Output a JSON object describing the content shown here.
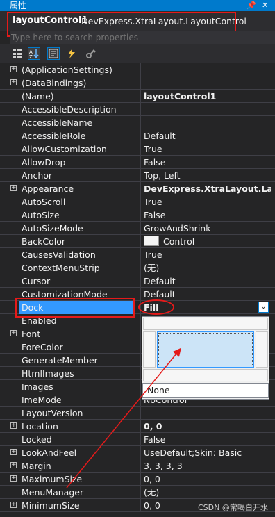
{
  "window": {
    "title": "属性",
    "pin_glyph": "📌",
    "close_glyph": "✕"
  },
  "object_selector": {
    "name": "layoutControl1",
    "type": "DevExpress.XtraLayout.LayoutControl"
  },
  "search": {
    "placeholder": "Type here to search properties"
  },
  "toolbar": {
    "buttons": [
      "categorized-icon",
      "alphabetical-icon",
      "properties-icon",
      "events-icon",
      "property-pages-icon"
    ]
  },
  "properties": [
    {
      "name": "(ApplicationSettings)",
      "value": "",
      "expandable": true
    },
    {
      "name": "(DataBindings)",
      "value": "",
      "expandable": true
    },
    {
      "name": "(Name)",
      "value": "layoutControl1",
      "bold": true
    },
    {
      "name": "AccessibleDescription",
      "value": ""
    },
    {
      "name": "AccessibleName",
      "value": ""
    },
    {
      "name": "AccessibleRole",
      "value": "Default"
    },
    {
      "name": "AllowCustomization",
      "value": "True"
    },
    {
      "name": "AllowDrop",
      "value": "False"
    },
    {
      "name": "Anchor",
      "value": "Top, Left"
    },
    {
      "name": "Appearance",
      "value": "DevExpress.XtraLayout.LayoutControlAppearance",
      "bold": true,
      "expandable": true
    },
    {
      "name": "AutoScroll",
      "value": "True"
    },
    {
      "name": "AutoSize",
      "value": "False"
    },
    {
      "name": "AutoSizeMode",
      "value": "GrowAndShrink"
    },
    {
      "name": "BackColor",
      "value": "Control",
      "swatch": true
    },
    {
      "name": "CausesValidation",
      "value": "True"
    },
    {
      "name": "ContextMenuStrip",
      "value": "(无)"
    },
    {
      "name": "Cursor",
      "value": "Default"
    },
    {
      "name": "CustomizationMode",
      "value": "Default"
    },
    {
      "name": "Dock",
      "value": "Fill",
      "bold": true,
      "selected": true
    },
    {
      "name": "Enabled",
      "value": ""
    },
    {
      "name": "Font",
      "value": "",
      "expandable": true
    },
    {
      "name": "ForeColor",
      "value": ""
    },
    {
      "name": "GenerateMember",
      "value": ""
    },
    {
      "name": "HtmlImages",
      "value": ""
    },
    {
      "name": "Images",
      "value": ""
    },
    {
      "name": "ImeMode",
      "value": "NoControl"
    },
    {
      "name": "LayoutVersion",
      "value": ""
    },
    {
      "name": "Location",
      "value": "0, 0",
      "bold": true,
      "expandable": true
    },
    {
      "name": "Locked",
      "value": "False"
    },
    {
      "name": "LookAndFeel",
      "value": "UseDefault;Skin: Basic",
      "expandable": true
    },
    {
      "name": "Margin",
      "value": "3, 3, 3, 3",
      "expandable": true
    },
    {
      "name": "MaximumSize",
      "value": "0, 0",
      "expandable": true
    },
    {
      "name": "MenuManager",
      "value": "(无)"
    },
    {
      "name": "MinimumSize",
      "value": "0, 0",
      "expandable": true
    }
  ],
  "dock_dropdown": {
    "options": [
      "Top",
      "Left",
      "Fill",
      "Right",
      "Bottom",
      "None"
    ],
    "selected": "Fill",
    "none_label": "None"
  },
  "watermark": "CSDN @常喝白开水",
  "colors": {
    "panel_bg": "#252526",
    "title_bar": "#007acc",
    "selection": "#3399ff",
    "annotation": "#e51a1a"
  }
}
